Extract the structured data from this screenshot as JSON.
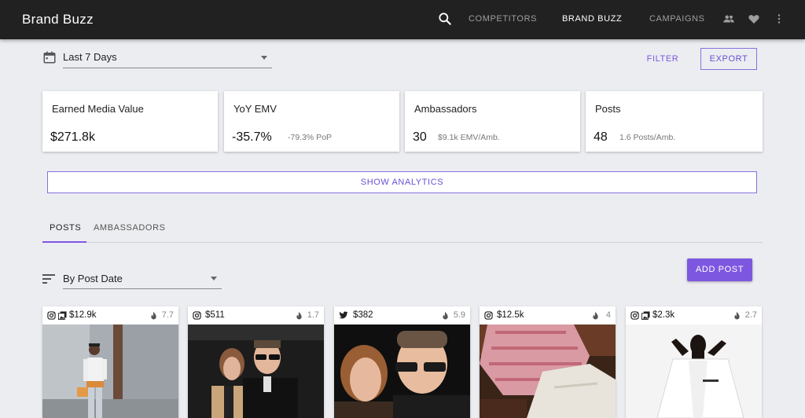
{
  "app": {
    "title": "Brand Buzz"
  },
  "nav": {
    "links": [
      {
        "label": "COMPETITORS",
        "active": false
      },
      {
        "label": "BRAND BUZZ",
        "active": true
      },
      {
        "label": "CAMPAIGNS",
        "active": false
      }
    ],
    "icons": [
      "search-icon",
      "people-icon",
      "heart-icon",
      "more-vert-icon"
    ]
  },
  "filters": {
    "date_range": "Last 7 Days",
    "filter_label": "FILTER",
    "export_label": "EXPORT"
  },
  "stats": [
    {
      "label": "Earned Media Value",
      "value": "$271.8k",
      "sub": ""
    },
    {
      "label": "YoY EMV",
      "value": "-35.7%",
      "sub": "-79.3% PoP"
    },
    {
      "label": "Ambassadors",
      "value": "30",
      "sub": "$9.1k EMV/Amb."
    },
    {
      "label": "Posts",
      "value": "48",
      "sub": "1.6 Posts/Amb."
    }
  ],
  "show_analytics_label": "SHOW ANALYTICS",
  "tabs": [
    {
      "label": "POSTS",
      "active": true
    },
    {
      "label": "AMBASSADORS",
      "active": false
    }
  ],
  "sort": {
    "value": "By Post Date"
  },
  "add_post_label": "ADD POST",
  "posts": [
    {
      "platform": "instagram",
      "multi": true,
      "emv": "$12.9k",
      "score": "7.7"
    },
    {
      "platform": "instagram",
      "multi": false,
      "emv": "$511",
      "score": "1.7"
    },
    {
      "platform": "twitter",
      "multi": false,
      "emv": "$382",
      "score": "5.9"
    },
    {
      "platform": "instagram",
      "multi": false,
      "emv": "$12.5k",
      "score": "4"
    },
    {
      "platform": "instagram",
      "multi": true,
      "emv": "$2.3k",
      "score": "2.7"
    }
  ],
  "colors": {
    "accent": "#7e57e0",
    "topbar": "#212121",
    "background": "#ebedf0"
  }
}
